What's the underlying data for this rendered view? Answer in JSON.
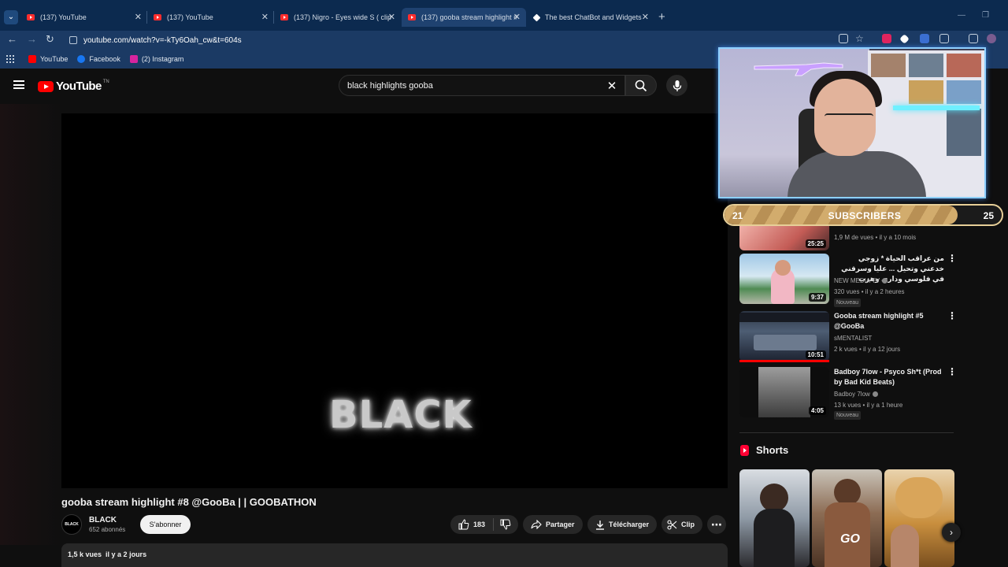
{
  "browser": {
    "tabs": [
      {
        "title": "(137) YouTube",
        "icon": "youtube-icon"
      },
      {
        "title": "(137) YouTube",
        "icon": "youtube-icon"
      },
      {
        "title": "(137) Nigro - Eyes wide S ( clip",
        "icon": "youtube-icon"
      },
      {
        "title": "(137) gooba stream highlight #",
        "icon": "youtube-icon",
        "active": true
      },
      {
        "title": "The best ChatBot and Widgets",
        "icon": "diamond-icon"
      }
    ],
    "url": "youtube.com/watch?v=-kTy6Oah_cw&t=604s",
    "bookmarks": [
      {
        "label": "YouTube",
        "color": "#ff0000"
      },
      {
        "label": "Facebook",
        "color": "#1877f2"
      },
      {
        "label": "(2) Instagram",
        "color": "#d6249f"
      }
    ]
  },
  "youtube": {
    "logo_text": "YouTube",
    "logo_tm": "TN",
    "search_query": "black highlights gooba"
  },
  "video": {
    "brand_text": "BLACK",
    "title": "gooba stream highlight #8 @GooBa | | GOOBATHON",
    "channel": "BLACK",
    "channel_avatar_text": "BLACK",
    "subscribers": "652 abonnés",
    "subscribe_label": "S'abonner",
    "likes": "183",
    "share_label": "Partager",
    "download_label": "Télécharger",
    "clip_label": "Clip",
    "views": "1,5 k vues",
    "age": "il y a 2 jours"
  },
  "overlay": {
    "sub_start": "21",
    "sub_label": "SUBSCRIBERS",
    "sub_end": "25",
    "progress_fraction": 0.84
  },
  "recommendations": [
    {
      "title": "",
      "channel": "",
      "meta": "1,9 M de vues • il y a 10 mois",
      "duration": "25:25",
      "is_new": false
    },
    {
      "title": "من عراقب الحياة * زوجي خدعني وتحيل ... عليا وسرقني في فلوسي وداري وهرب",
      "channel": "NEW MEDIA TV",
      "meta": "320 vues • il y a 2 heures",
      "duration": "9:37",
      "is_new": true,
      "verified": true
    },
    {
      "title": "Gooba stream highlight #5 @GooBa",
      "channel": "sMENTALIST",
      "meta": "2 k vues • il y a 12 jours",
      "duration": "10:51",
      "is_new": false
    },
    {
      "title": "Badboy 7low - Psyco Sh*t (Prod by Bad Kid Beats)",
      "channel": "Badboy 7low",
      "meta": "13 k vues • il y a 1 heure",
      "duration": "4:05",
      "is_new": true,
      "verified": true
    }
  ],
  "new_badge": "Nouveau",
  "shorts": {
    "heading": "Shorts",
    "short3_text": "GO"
  },
  "colors": {
    "youtube_red": "#ff0000",
    "tab_bar": "#0c2a4f",
    "nav_bar": "#1b3a64",
    "subbar_gold": "#d2ac6d",
    "webcam_border": "#8ed0ff"
  }
}
